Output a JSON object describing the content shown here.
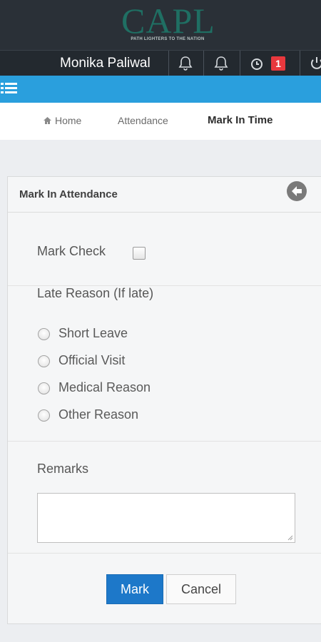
{
  "logo": {
    "text": "CAPL",
    "tagline": "PATH LIGHTERS TO THE NATION"
  },
  "user": {
    "name": "Monika Paliwal"
  },
  "header_icons": [
    "bell-icon",
    "bell-icon",
    "clock-icon",
    "power-icon"
  ],
  "notification_badge": "1",
  "menu_icon": "list-menu-icon",
  "breadcrumb": {
    "home": "Home",
    "attendance": "Attendance",
    "current": "Mark In Time"
  },
  "panel": {
    "title": "Mark In Attendance",
    "back_icon": "back-arrow-icon",
    "mark_check_label": "Mark Check",
    "mark_check_checked": false,
    "late_reason_label": "Late Reason (If late)",
    "reasons": [
      {
        "label": "Short Leave",
        "selected": false
      },
      {
        "label": "Official Visit",
        "selected": false
      },
      {
        "label": "Medical Reason",
        "selected": false
      },
      {
        "label": "Other Reason",
        "selected": false
      }
    ],
    "remarks_label": "Remarks",
    "remarks_value": "",
    "mark_button": "Mark",
    "cancel_button": "Cancel"
  },
  "colors": {
    "accent_blue": "#2a9fdd",
    "button_blue": "#1d78c9",
    "badge_red": "#e8383d",
    "header_dark": "#2a3037"
  }
}
